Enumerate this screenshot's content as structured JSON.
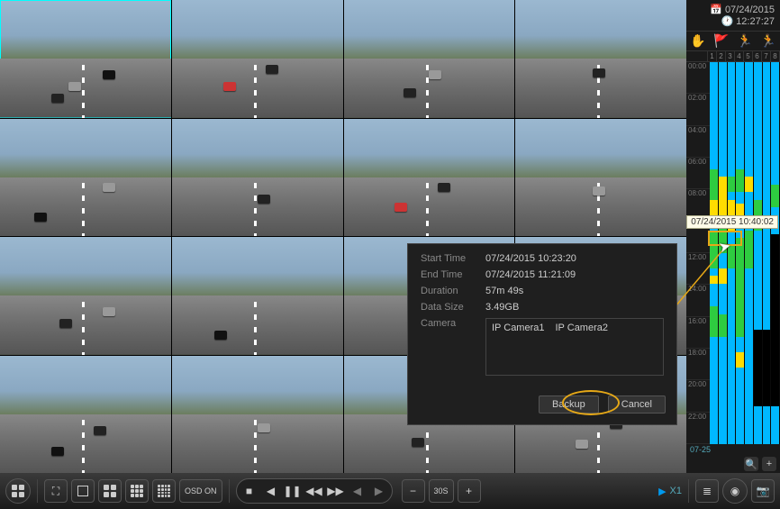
{
  "header": {
    "date": "07/24/2015",
    "time": "12:27:27"
  },
  "timeline": {
    "columns": [
      "1",
      "2",
      "3",
      "4",
      "5",
      "6",
      "7",
      "8"
    ],
    "hours": [
      "00:00",
      "02:00",
      "04:00",
      "06:00",
      "08:00",
      "10:00",
      "12:00",
      "14:00",
      "16:00",
      "18:00",
      "20:00",
      "22:00"
    ],
    "tooltip": "07/24/2015 10:40:02",
    "selection_highlight": true,
    "next_date_label": "07-25"
  },
  "legend": {
    "scheduled": "scheduled-icon",
    "alarm": "alarm-icon",
    "motion": "motion-icon",
    "manual": "manual-icon"
  },
  "modal": {
    "labels": {
      "start_time": "Start Time",
      "end_time": "End Time",
      "duration": "Duration",
      "data_size": "Data Size",
      "camera": "Camera"
    },
    "values": {
      "start_time": "07/24/2015 10:23:20",
      "end_time": "07/24/2015 11:21:09",
      "duration": "57m 49s",
      "data_size": "3.49GB"
    },
    "cameras": [
      "IP Camera1",
      "IP Camera2"
    ],
    "buttons": {
      "backup": "Backup",
      "cancel": "Cancel"
    }
  },
  "toolbar": {
    "osd": "OSD ON",
    "interval": "30S",
    "speed": "X1"
  },
  "cameras_grid": {
    "rows": 4,
    "cols": 4,
    "selected_index": 0
  }
}
